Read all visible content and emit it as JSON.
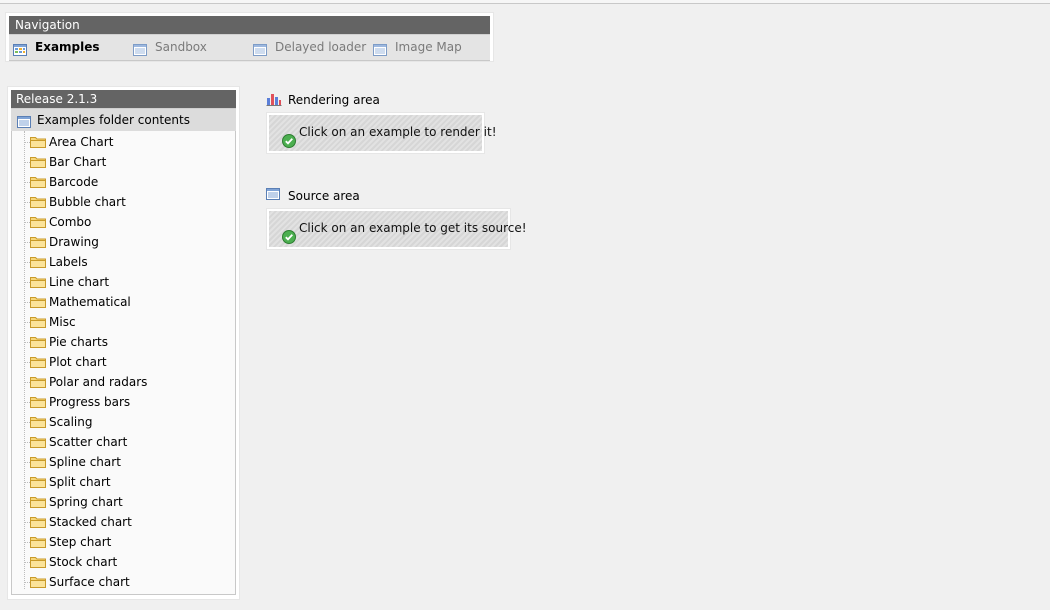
{
  "navigation": {
    "title": "Navigation",
    "tabs": [
      {
        "label": "Examples",
        "icon": "table-icon",
        "active": true
      },
      {
        "label": "Sandbox",
        "icon": "list-icon",
        "active": false
      },
      {
        "label": "Delayed loader",
        "icon": "list-icon",
        "active": false
      },
      {
        "label": "Image Map",
        "icon": "list-icon",
        "active": false
      }
    ]
  },
  "release": {
    "title": "Release 2.1.3",
    "root_label": "Examples folder contents",
    "folders": [
      "Area Chart",
      "Bar Chart",
      "Barcode",
      "Bubble chart",
      "Combo",
      "Drawing",
      "Labels",
      "Line chart",
      "Mathematical",
      "Misc",
      "Pie charts",
      "Plot chart",
      "Polar and radars",
      "Progress bars",
      "Scaling",
      "Scatter chart",
      "Spline chart",
      "Split chart",
      "Spring chart",
      "Stacked chart",
      "Step chart",
      "Stock chart",
      "Surface chart"
    ]
  },
  "rendering": {
    "title": "Rendering area",
    "message": "Click on an example to render it!"
  },
  "source": {
    "title": "Source area",
    "message": "Click on an example to get its source!"
  },
  "colors": {
    "panel_header": "#646464",
    "folder": "#f2c85a",
    "ok_icon": "#4caf50"
  }
}
